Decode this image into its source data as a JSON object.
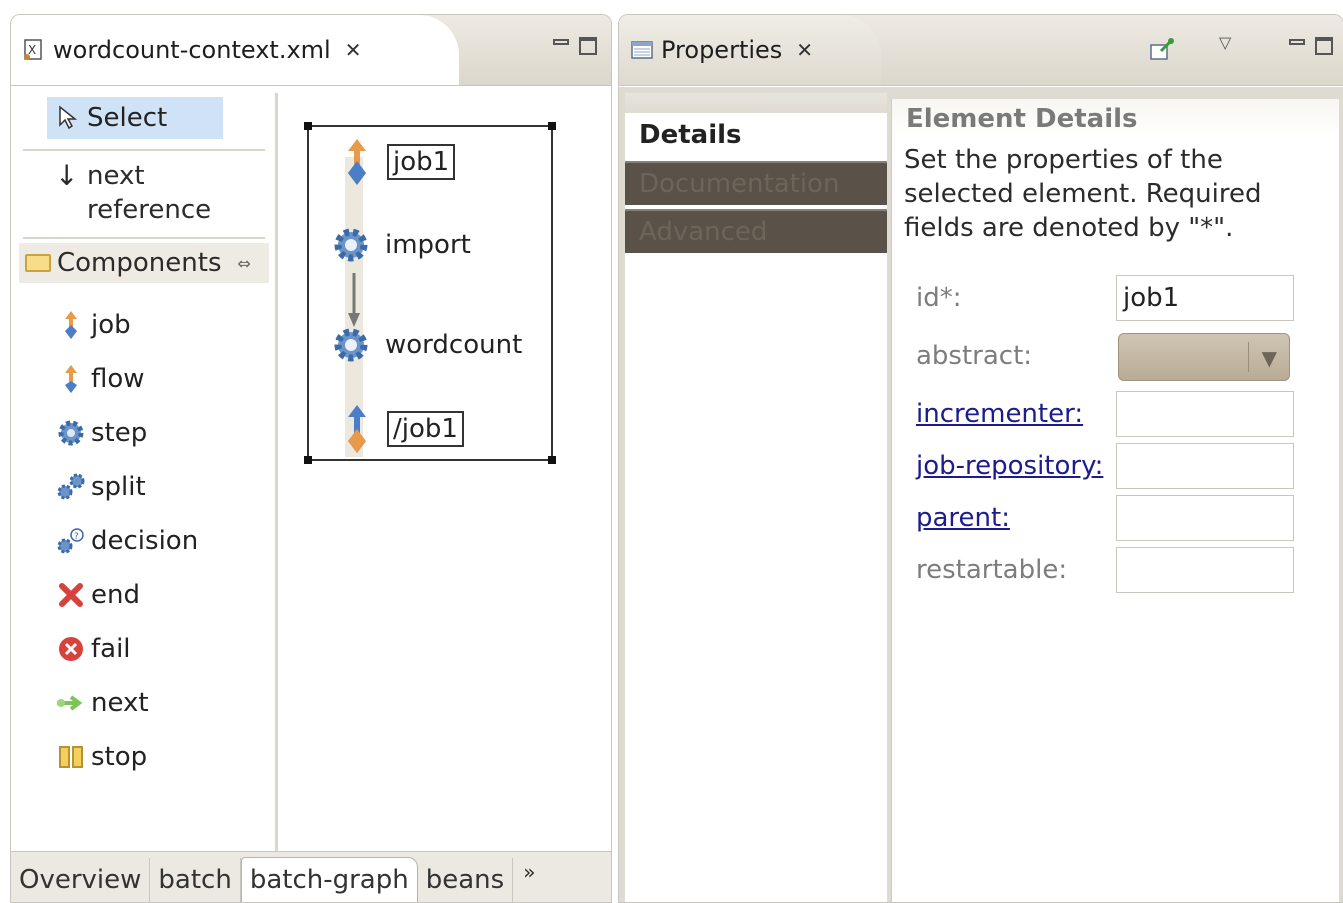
{
  "editor": {
    "tab_title": "wordcount-context.xml",
    "close_glyph": "✕",
    "palette": {
      "select_label": "Select",
      "next_reference_label_1": "next",
      "next_reference_label_2": "reference",
      "components_label": "Components",
      "items": [
        {
          "label": "job",
          "icon": "job-icon"
        },
        {
          "label": "flow",
          "icon": "flow-icon"
        },
        {
          "label": "step",
          "icon": "step-icon"
        },
        {
          "label": "split",
          "icon": "split-icon"
        },
        {
          "label": "decision",
          "icon": "decision-icon"
        },
        {
          "label": "end",
          "icon": "end-icon"
        },
        {
          "label": "fail",
          "icon": "fail-icon"
        },
        {
          "label": "next",
          "icon": "next-icon"
        },
        {
          "label": "stop",
          "icon": "stop-icon"
        }
      ]
    },
    "diagram": {
      "start_tag": "job1",
      "steps": [
        "import",
        "wordcount"
      ],
      "end_tag": "/job1"
    },
    "bottom_tabs": [
      "Overview",
      "batch",
      "batch-graph",
      "beans"
    ],
    "active_bottom_tab": "batch-graph",
    "more_glyph": "»"
  },
  "properties": {
    "tab_title": "Properties",
    "close_glyph": "✕",
    "tabs": [
      "Details",
      "Documentation",
      "Advanced"
    ],
    "active_tab": "Details",
    "section_title": "Element Details",
    "description": "Set the properties of the selected element. Required fields are denoted by \"*\".",
    "fields": {
      "id_label": "id*:",
      "id_value": "job1",
      "abstract_label": "abstract:",
      "incrementer_label": "incrementer:",
      "job_repository_label": "job-repository:",
      "parent_label": "parent:",
      "restartable_label": "restartable:"
    }
  },
  "colors": {
    "selection": "#cfe2f6",
    "link": "#1c1c8e",
    "dark_tab": "#5a5248"
  }
}
